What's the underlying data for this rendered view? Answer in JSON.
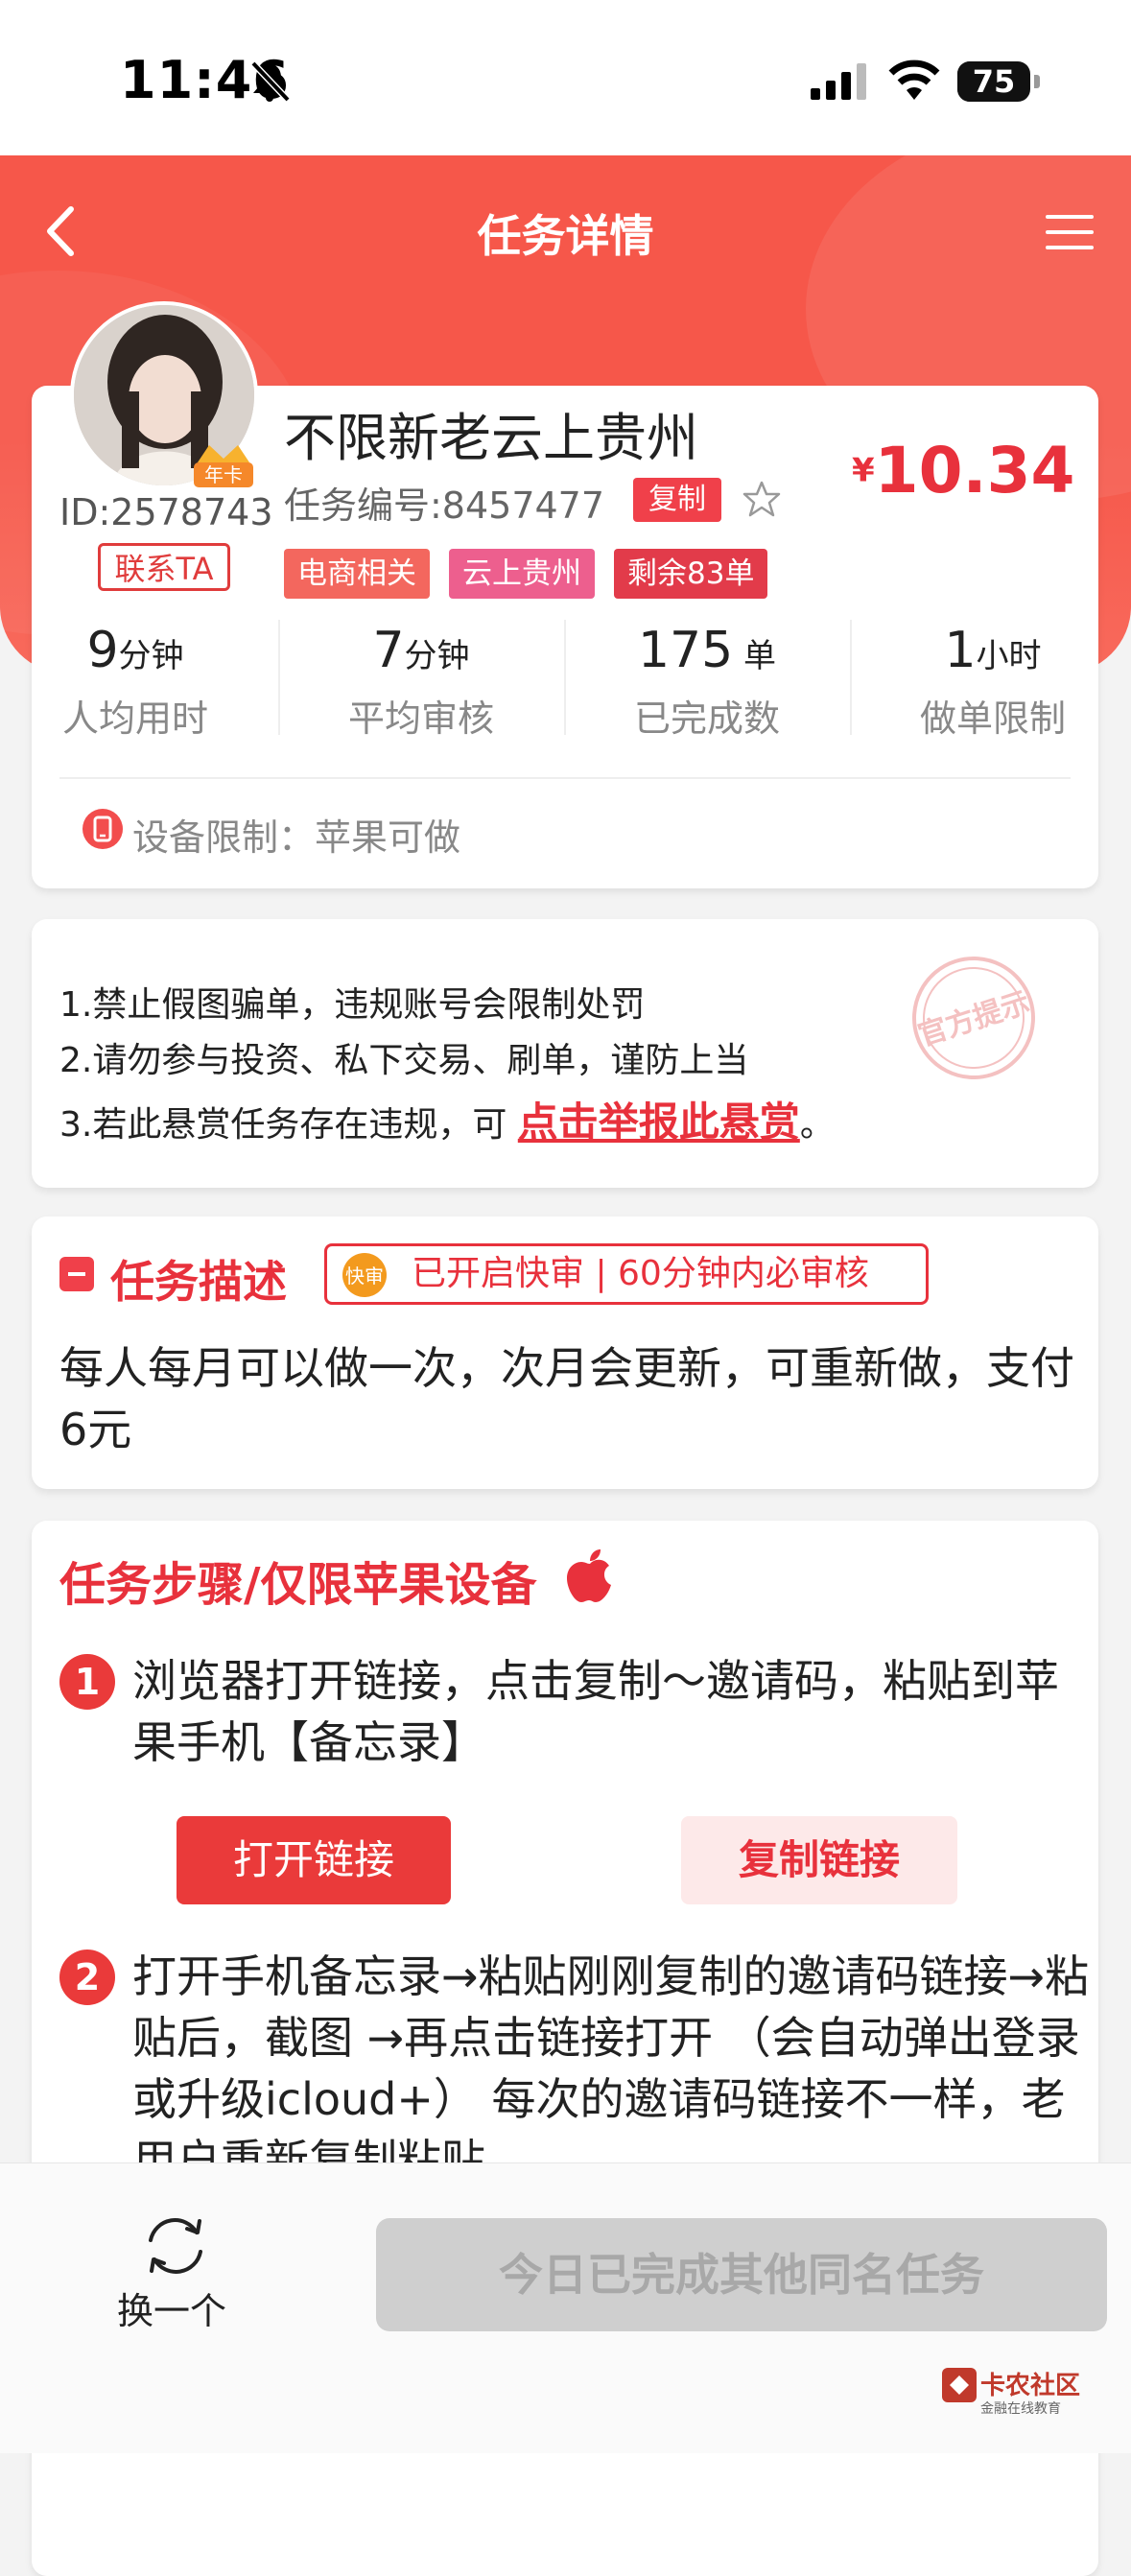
{
  "status": {
    "time": "11:46",
    "battery": "75",
    "battery_level": 0.75
  },
  "nav": {
    "title": "任务详情"
  },
  "profile": {
    "id": "ID:2578743",
    "contact": "联系TA",
    "badge": "年卡"
  },
  "task": {
    "title": "不限新老云上贵州",
    "number": "任务编号:8457477",
    "copy": "复制",
    "price_symbol": "¥",
    "price": "10.34",
    "tags": [
      "电商相关",
      "云上贵州",
      "剩余83单"
    ]
  },
  "stats": [
    {
      "value": "9",
      "unit": "分钟",
      "label": "人均用时"
    },
    {
      "value": "7",
      "unit": "分钟",
      "label": "平均审核"
    },
    {
      "value": "175",
      "unit": " 单",
      "label": "已完成数"
    },
    {
      "value": "1",
      "unit": "小时",
      "label": "做单限制"
    }
  ],
  "device": {
    "label": "设备限制：",
    "value": "苹果可做"
  },
  "warnings": {
    "line1": "1.禁止假图骗单，违规账号会限制处罚",
    "line2": "2.请勿参与投资、私下交易、刷单，谨防上当",
    "line3_prefix": "3.若此悬赏任务存在违规，可 ",
    "line3_link": "点击举报此悬赏",
    "line3_suffix": "。",
    "stamp": "官方提示"
  },
  "description": {
    "title": "任务描述",
    "fast_icon": "快审",
    "fast_text": "已开启快审 | 60分钟内必审核",
    "text": "每人每月可以做一次，次月会更新，可重新做，支付6元"
  },
  "steps": {
    "title": "任务步骤/仅限苹果设备",
    "items": [
      {
        "num": "1",
        "text": "浏览器打开链接，点击复制～邀请码，粘贴到苹果手机【备忘录】"
      },
      {
        "num": "2",
        "text": "打开手机备忘录→粘贴刚刚复制的邀请码链接→粘贴后，截图 →再点击链接打开 （会自动弹出登录或升级icloud+） 每次的邀请码链接不一样，老用户重新复制粘贴"
      }
    ],
    "open_btn": "打开链接",
    "copy_btn": "复制链接"
  },
  "bottom": {
    "switch_label": "换一个",
    "done_label": "今日已完成其他同名任务"
  },
  "watermark": {
    "title": "卡农社区",
    "subtitle": "金融在线教育"
  },
  "colors": {
    "primary": "#f6574a",
    "accent": "#e8313c"
  },
  "icons": [
    "bell-mute-icon",
    "signal-icon",
    "wifi-icon",
    "battery-icon",
    "back-icon",
    "menu-icon",
    "star-icon",
    "phone-icon",
    "apple-icon",
    "refresh-icon"
  ]
}
